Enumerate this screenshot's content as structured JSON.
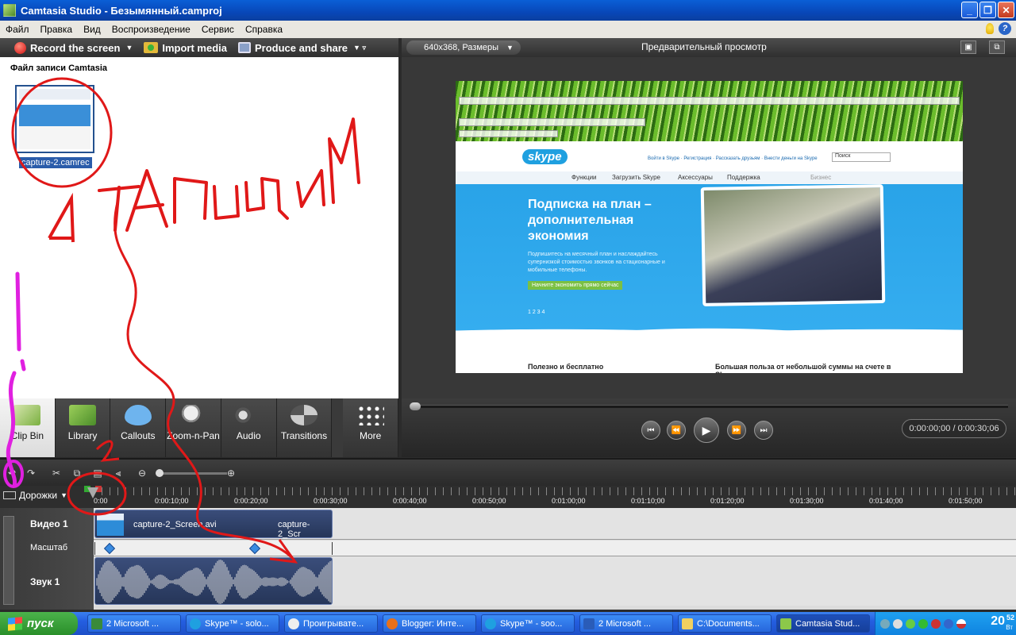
{
  "window": {
    "title": "Camtasia Studio - Безымянный.camproj"
  },
  "menu": [
    "Файл",
    "Правка",
    "Вид",
    "Воспроизведение",
    "Сервис",
    "Справка"
  ],
  "left_toolbar": {
    "record": "Record the screen",
    "import": "Import media",
    "produce": "Produce and share"
  },
  "clip_bin": {
    "header": "Файл записи Camtasia",
    "clip_name": "capture-2.camrec"
  },
  "tabs": [
    {
      "label": "Clip Bin"
    },
    {
      "label": "Library"
    },
    {
      "label": "Callouts"
    },
    {
      "label": "Zoom-n-Pan"
    },
    {
      "label": "Audio"
    },
    {
      "label": "Transitions"
    },
    {
      "label": "More"
    }
  ],
  "preview": {
    "size_dropdown": "640x368, Размеры",
    "title": "Предварительный просмотр",
    "timecode": "0:00:00;00 / 0:00:30;06"
  },
  "webpage": {
    "logo": "skype",
    "links": "Войти в Skype · Регистрация · Рассказать друзьям · Внести деньги на Skype",
    "search": "Поиск",
    "nav": [
      "Функции",
      "Загрузить Skype",
      "Аксессуары",
      "Поддержка",
      "Бизнес"
    ],
    "hero_title": "Подписка на план – дополнительная экономия",
    "hero_sub": "Подпишитесь на месячный план и наслаждайтесь супернизкой стоимостью звонков на стационарные и мобильные телефоны.",
    "hero_button": "Начните экономить прямо сейчас",
    "pager": "1 2 3 4",
    "col1_title": "Полезно и бесплатно",
    "col2_title": "Большая польза от небольшой суммы на счете в Skype"
  },
  "timeline": {
    "tracks_label": "Дорожки",
    "ticks": [
      "0:00",
      "0:00:10;00",
      "0:00:20;00",
      "0:00:30;00",
      "0:00:40;00",
      "0:00:50;00",
      "0:01:00;00",
      "0:01:10;00",
      "0:01:20;00",
      "0:01:30;00",
      "0:01:40;00",
      "0:01:50;00"
    ],
    "video_track": "Видео 1",
    "zoom_track": "Масштаб",
    "audio_track": "Звук 1",
    "video_clip_name": "capture-2_Screen.avi",
    "video_clip_name_2": "capture-2_Scr"
  },
  "annotations": {
    "step1": "1 ТАЩИМ",
    "step2": "2"
  },
  "taskbar": {
    "start": "пуск",
    "items": [
      "2 Microsoft ...",
      "Skype™ - solo...",
      "Проигрывате...",
      "Blogger: Инте...",
      "Skype™ - soo...",
      "2 Microsoft ...",
      "C:\\Documents...",
      "Camtasia Stud..."
    ],
    "clock": "20",
    "clock_min": "52",
    "clock_day": "Вт"
  },
  "colors": {
    "accent": "#0a5fd6",
    "annotation_red": "#e01818",
    "annotation_magenta": "#e020e0"
  }
}
